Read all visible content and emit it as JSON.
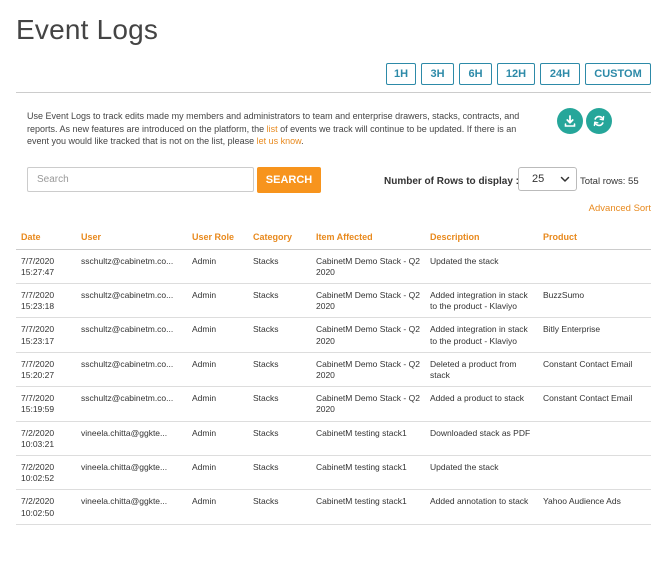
{
  "page_title": "Event Logs",
  "range_buttons": [
    "1H",
    "3H",
    "6H",
    "12H",
    "24H",
    "CUSTOM"
  ],
  "description": {
    "text1": "Use Event Logs to track edits made my members and administrators to team and enterprise drawers, stacks, contracts, and reports. As new features are introduced on the platform, the ",
    "link1": "list",
    "text2": " of events we track will continue to be updated. If there is an event you would like tracked that is not on the list, please ",
    "link2": "let us know",
    "text3": "."
  },
  "icons": {
    "download": "download-icon",
    "refresh": "refresh-icon",
    "accent": "#26a69a"
  },
  "search": {
    "placeholder": "Search",
    "value": "",
    "button_label": "SEARCH"
  },
  "rows_display": {
    "label": "Number of Rows to display :",
    "selected": "25",
    "total_label": "Total rows: 55"
  },
  "advanced_sort": "Advanced Sort",
  "colors": {
    "accent_orange": "#e8891d",
    "button_orange": "#f7941d",
    "outline_blue": "#2d8aa8"
  },
  "table": {
    "headers": [
      "Date",
      "User",
      "User Role",
      "Category",
      "Item Affected",
      "Description",
      "Product"
    ],
    "rows": [
      [
        "7/7/2020 15:27:47",
        "sschultz@cabinetm.co...",
        "Admin",
        "Stacks",
        "CabinetM Demo Stack - Q2 2020",
        "Updated the stack",
        ""
      ],
      [
        "7/7/2020 15:23:18",
        "sschultz@cabinetm.co...",
        "Admin",
        "Stacks",
        "CabinetM Demo Stack - Q2 2020",
        "Added integration in stack to the product - Klaviyo",
        "BuzzSumo"
      ],
      [
        "7/7/2020 15:23:17",
        "sschultz@cabinetm.co...",
        "Admin",
        "Stacks",
        "CabinetM Demo Stack - Q2 2020",
        "Added integration in stack to the product - Klaviyo",
        "Bitly Enterprise"
      ],
      [
        "7/7/2020 15:20:27",
        "sschultz@cabinetm.co...",
        "Admin",
        "Stacks",
        "CabinetM Demo Stack - Q2 2020",
        "Deleted a product from stack",
        "Constant Contact Email"
      ],
      [
        "7/7/2020 15:19:59",
        "sschultz@cabinetm.co...",
        "Admin",
        "Stacks",
        "CabinetM Demo Stack - Q2 2020",
        "Added a product to stack",
        "Constant Contact Email"
      ],
      [
        "7/2/2020 10:03:21",
        "vineela.chitta@ggkte...",
        "Admin",
        "Stacks",
        "CabinetM testing stack1",
        "Downloaded stack as PDF",
        ""
      ],
      [
        "7/2/2020 10:02:52",
        "vineela.chitta@ggkte...",
        "Admin",
        "Stacks",
        "CabinetM testing stack1",
        "Updated the stack",
        ""
      ],
      [
        "7/2/2020 10:02:50",
        "vineela.chitta@ggkte...",
        "Admin",
        "Stacks",
        "CabinetM testing stack1",
        "Added annotation to stack",
        "Yahoo Audience Ads"
      ]
    ]
  }
}
